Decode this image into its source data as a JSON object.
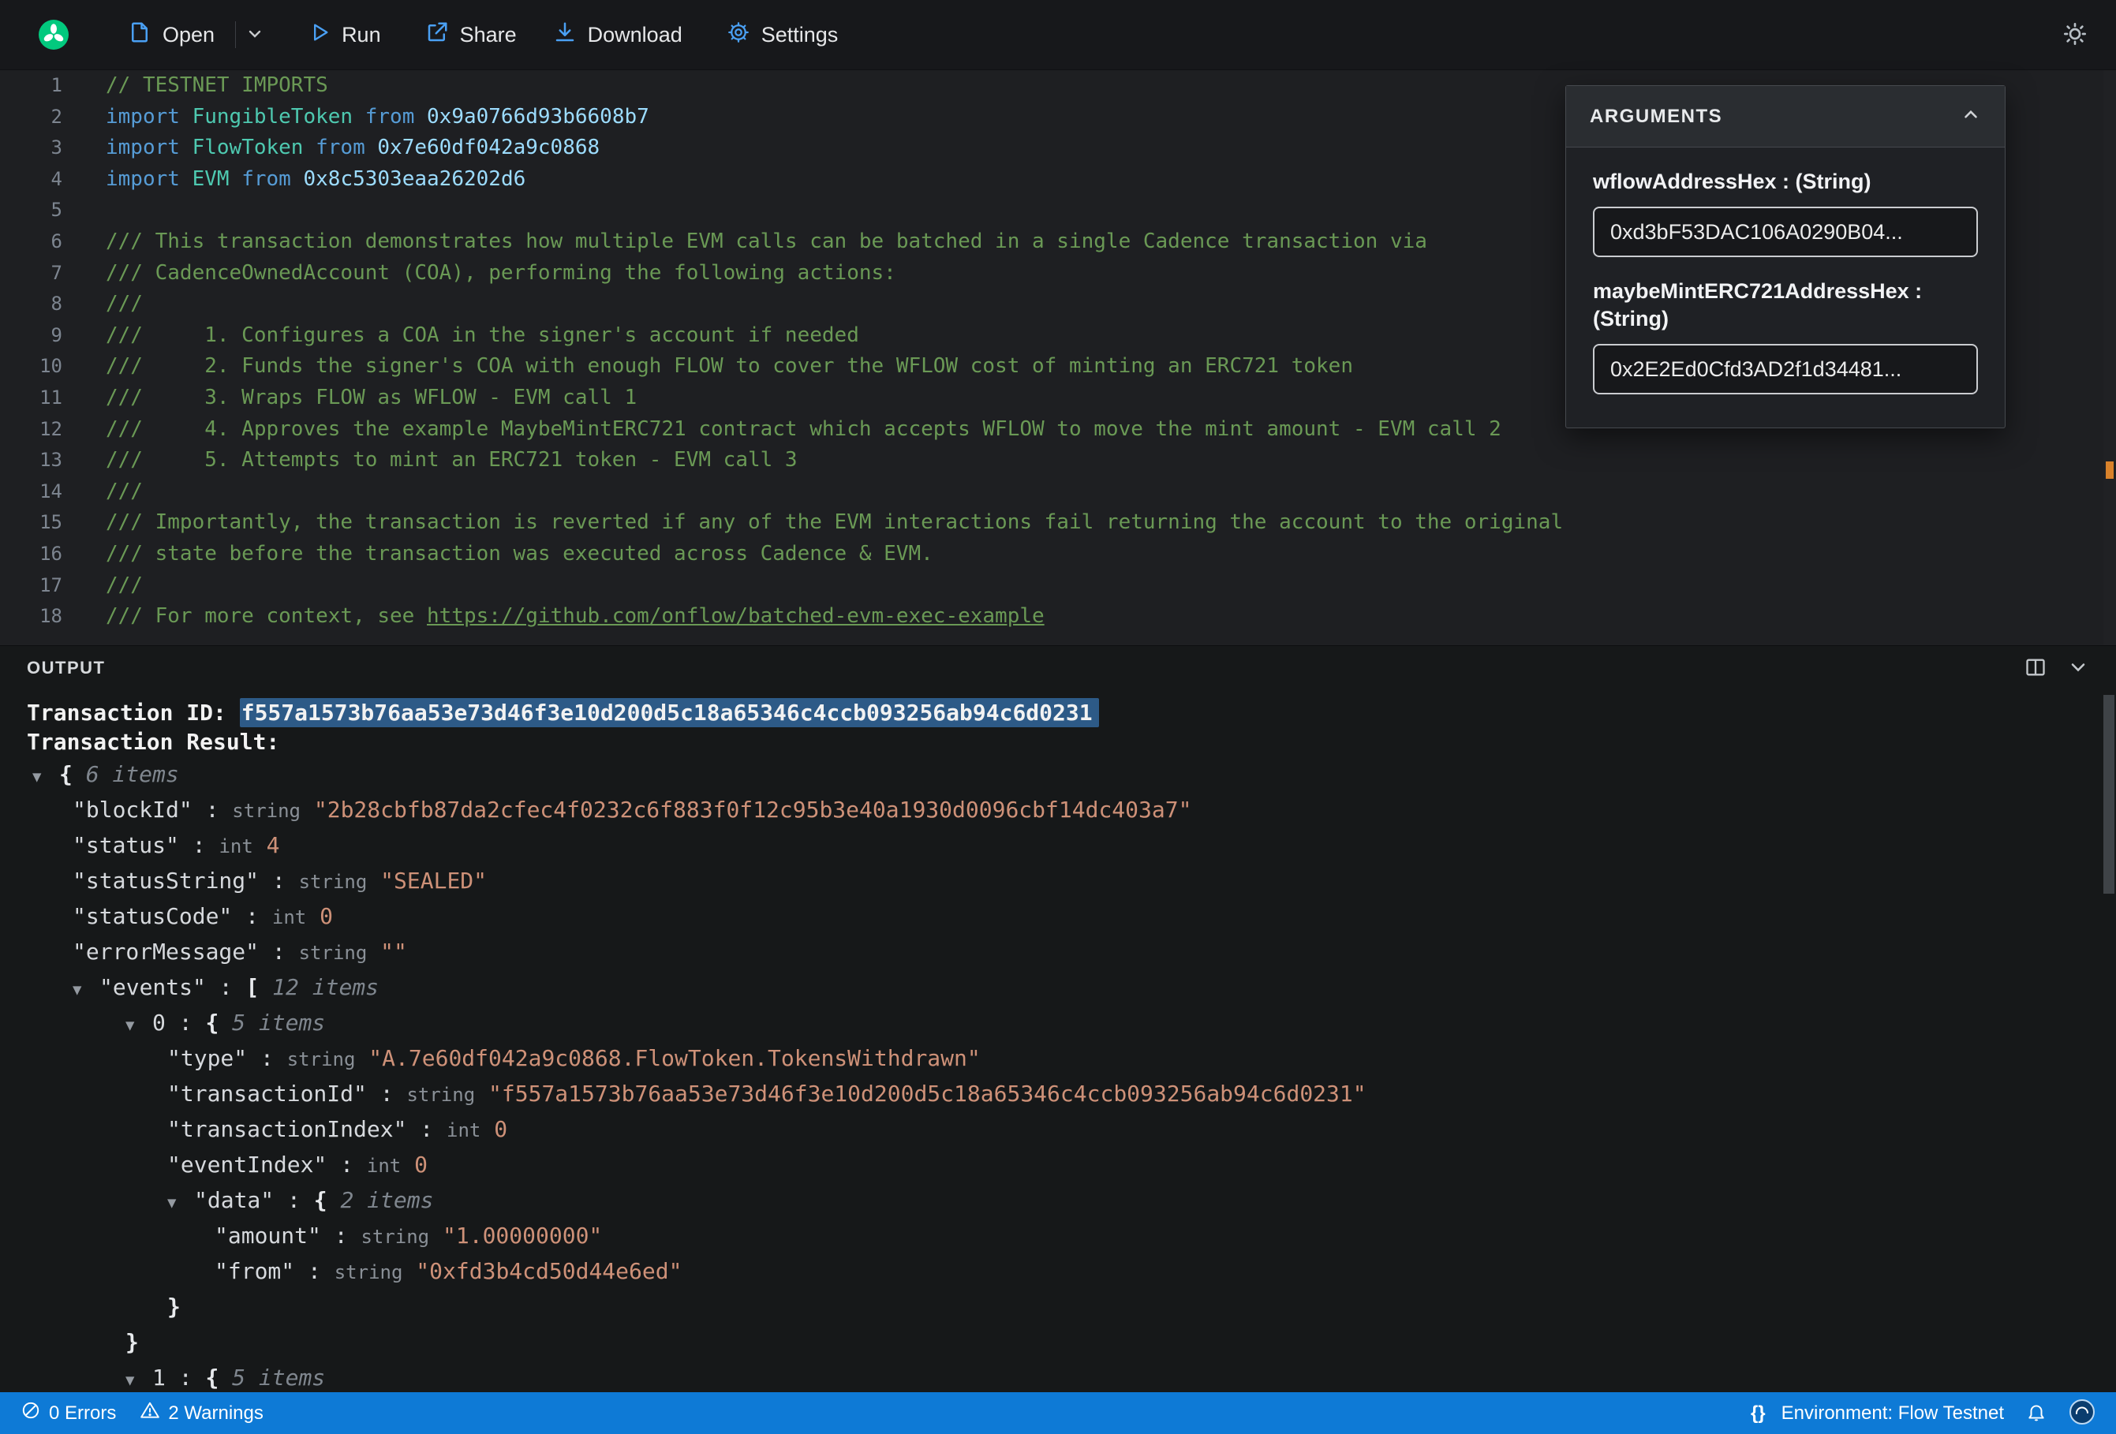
{
  "toolbar": {
    "open": "Open",
    "run": "Run",
    "share": "Share",
    "download": "Download",
    "settings": "Settings"
  },
  "arguments_panel": {
    "title": "ARGUMENTS",
    "fields": [
      {
        "label": "wflowAddressHex : (String)",
        "value": "0xd3bF53DAC106A0290B04..."
      },
      {
        "label": "maybeMintERC721AddressHex : (String)",
        "value": "0x2E2Ed0Cfd3AD2f1d34481..."
      }
    ]
  },
  "editor": {
    "lines": [
      {
        "n": 1,
        "s": [
          [
            "cm",
            "// TESTNET IMPORTS"
          ]
        ]
      },
      {
        "n": 2,
        "s": [
          [
            "kw",
            "import"
          ],
          [
            "pl",
            " "
          ],
          [
            "mod",
            "FungibleToken"
          ],
          [
            "pl",
            " "
          ],
          [
            "kw",
            "from"
          ],
          [
            "pl",
            " "
          ],
          [
            "addr",
            "0x9a0766d93b6608b7"
          ]
        ]
      },
      {
        "n": 3,
        "s": [
          [
            "kw",
            "import"
          ],
          [
            "pl",
            " "
          ],
          [
            "mod",
            "FlowToken"
          ],
          [
            "pl",
            " "
          ],
          [
            "kw",
            "from"
          ],
          [
            "pl",
            " "
          ],
          [
            "addr",
            "0x7e60df042a9c0868"
          ]
        ]
      },
      {
        "n": 4,
        "s": [
          [
            "kw",
            "import"
          ],
          [
            "pl",
            " "
          ],
          [
            "mod",
            "EVM"
          ],
          [
            "pl",
            " "
          ],
          [
            "kw",
            "from"
          ],
          [
            "pl",
            " "
          ],
          [
            "addr",
            "0x8c5303eaa26202d6"
          ]
        ]
      },
      {
        "n": 5,
        "s": []
      },
      {
        "n": 6,
        "s": [
          [
            "cm",
            "/// This transaction demonstrates how multiple EVM calls can be batched in a single Cadence transaction via"
          ]
        ]
      },
      {
        "n": 7,
        "s": [
          [
            "cm",
            "/// CadenceOwnedAccount (COA), performing the following actions:"
          ]
        ]
      },
      {
        "n": 8,
        "s": [
          [
            "cm",
            "///"
          ]
        ]
      },
      {
        "n": 9,
        "s": [
          [
            "cm",
            "///     1. Configures a COA in the signer's account if needed"
          ]
        ]
      },
      {
        "n": 10,
        "s": [
          [
            "cm",
            "///     2. Funds the signer's COA with enough FLOW to cover the WFLOW cost of minting an ERC721 token"
          ]
        ]
      },
      {
        "n": 11,
        "s": [
          [
            "cm",
            "///     3. Wraps FLOW as WFLOW - EVM call 1"
          ]
        ]
      },
      {
        "n": 12,
        "s": [
          [
            "cm",
            "///     4. Approves the example MaybeMintERC721 contract which accepts WFLOW to move the mint amount - EVM call 2"
          ]
        ]
      },
      {
        "n": 13,
        "s": [
          [
            "cm",
            "///     5. Attempts to mint an ERC721 token - EVM call 3"
          ]
        ]
      },
      {
        "n": 14,
        "s": [
          [
            "cm",
            "///"
          ]
        ]
      },
      {
        "n": 15,
        "s": [
          [
            "cm",
            "/// Importantly, the transaction is reverted if any of the EVM interactions fail returning the account to the original"
          ]
        ]
      },
      {
        "n": 16,
        "s": [
          [
            "cm",
            "/// state before the transaction was executed across Cadence & EVM."
          ]
        ]
      },
      {
        "n": 17,
        "s": [
          [
            "cm",
            "///"
          ]
        ]
      },
      {
        "n": 18,
        "s": [
          [
            "cm",
            "/// For more context, see "
          ],
          [
            "lnk",
            "https://github.com/onflow/batched-evm-exec-example"
          ]
        ]
      }
    ]
  },
  "output": {
    "title": "OUTPUT",
    "tx_id_label": "Transaction ID: ",
    "tx_id": "f557a1573b76aa53e73d46f3e10d200d5c18a65346c4ccb093256ab94c6d0231",
    "tx_result_label": "Transaction Result:",
    "tree": [
      {
        "i": 0,
        "a": true,
        "s": [
          [
            "brc",
            "{ "
          ],
          [
            "itm",
            "6 items"
          ]
        ]
      },
      {
        "i": 1,
        "a": false,
        "s": [
          [
            "key",
            "\"blockId\""
          ],
          [
            "col",
            " : "
          ],
          [
            "typ",
            "string"
          ],
          [
            "col",
            " "
          ],
          [
            "str",
            "\"2b28cbfb87da2cfec4f0232c6f883f0f12c95b3e40a1930d0096cbf14dc403a7\""
          ]
        ]
      },
      {
        "i": 1,
        "a": false,
        "s": [
          [
            "key",
            "\"status\""
          ],
          [
            "col",
            " : "
          ],
          [
            "typ",
            "int"
          ],
          [
            "col",
            " "
          ],
          [
            "num",
            "4"
          ]
        ]
      },
      {
        "i": 1,
        "a": false,
        "s": [
          [
            "key",
            "\"statusString\""
          ],
          [
            "col",
            " : "
          ],
          [
            "typ",
            "string"
          ],
          [
            "col",
            " "
          ],
          [
            "str",
            "\"SEALED\""
          ]
        ]
      },
      {
        "i": 1,
        "a": false,
        "s": [
          [
            "key",
            "\"statusCode\""
          ],
          [
            "col",
            " : "
          ],
          [
            "typ",
            "int"
          ],
          [
            "col",
            " "
          ],
          [
            "num",
            "0"
          ]
        ]
      },
      {
        "i": 1,
        "a": false,
        "s": [
          [
            "key",
            "\"errorMessage\""
          ],
          [
            "col",
            " : "
          ],
          [
            "typ",
            "string"
          ],
          [
            "col",
            " "
          ],
          [
            "str",
            "\"\""
          ]
        ]
      },
      {
        "i": 1,
        "a": true,
        "s": [
          [
            "key",
            "\"events\""
          ],
          [
            "col",
            " : "
          ],
          [
            "brc",
            "[ "
          ],
          [
            "itm",
            "12 items"
          ]
        ]
      },
      {
        "i": 2,
        "a": true,
        "s": [
          [
            "key",
            "0"
          ],
          [
            "col",
            " : "
          ],
          [
            "brc",
            "{ "
          ],
          [
            "itm",
            "5 items"
          ]
        ]
      },
      {
        "i": 3,
        "a": false,
        "s": [
          [
            "key",
            "\"type\""
          ],
          [
            "col",
            " : "
          ],
          [
            "typ",
            "string"
          ],
          [
            "col",
            " "
          ],
          [
            "str",
            "\"A.7e60df042a9c0868.FlowToken.TokensWithdrawn\""
          ]
        ]
      },
      {
        "i": 3,
        "a": false,
        "s": [
          [
            "key",
            "\"transactionId\""
          ],
          [
            "col",
            " : "
          ],
          [
            "typ",
            "string"
          ],
          [
            "col",
            " "
          ],
          [
            "str",
            "\"f557a1573b76aa53e73d46f3e10d200d5c18a65346c4ccb093256ab94c6d0231\""
          ]
        ]
      },
      {
        "i": 3,
        "a": false,
        "s": [
          [
            "key",
            "\"transactionIndex\""
          ],
          [
            "col",
            " : "
          ],
          [
            "typ",
            "int"
          ],
          [
            "col",
            " "
          ],
          [
            "num",
            "0"
          ]
        ]
      },
      {
        "i": 3,
        "a": false,
        "s": [
          [
            "key",
            "\"eventIndex\""
          ],
          [
            "col",
            " : "
          ],
          [
            "typ",
            "int"
          ],
          [
            "col",
            " "
          ],
          [
            "num",
            "0"
          ]
        ]
      },
      {
        "i": 3,
        "a": true,
        "s": [
          [
            "key",
            "\"data\""
          ],
          [
            "col",
            " : "
          ],
          [
            "brc",
            "{ "
          ],
          [
            "itm",
            "2 items"
          ]
        ]
      },
      {
        "i": 4,
        "a": false,
        "s": [
          [
            "key",
            "\"amount\""
          ],
          [
            "col",
            " : "
          ],
          [
            "typ",
            "string"
          ],
          [
            "col",
            " "
          ],
          [
            "str",
            "\"1.00000000\""
          ]
        ]
      },
      {
        "i": 4,
        "a": false,
        "s": [
          [
            "key",
            "\"from\""
          ],
          [
            "col",
            " : "
          ],
          [
            "typ",
            "string"
          ],
          [
            "col",
            " "
          ],
          [
            "str",
            "\"0xfd3b4cd50d44e6ed\""
          ]
        ]
      },
      {
        "i": 3,
        "a": false,
        "s": [
          [
            "brc",
            "}"
          ]
        ]
      },
      {
        "i": 2,
        "a": false,
        "s": [
          [
            "brc",
            "}"
          ]
        ]
      },
      {
        "i": 2,
        "a": true,
        "s": [
          [
            "key",
            "1"
          ],
          [
            "col",
            " : "
          ],
          [
            "brc",
            "{ "
          ],
          [
            "itm",
            "5 items"
          ]
        ]
      }
    ]
  },
  "status_bar": {
    "errors": "0 Errors",
    "warnings": "2 Warnings",
    "env_icon": "{}",
    "environment": "Environment: Flow Testnet"
  }
}
